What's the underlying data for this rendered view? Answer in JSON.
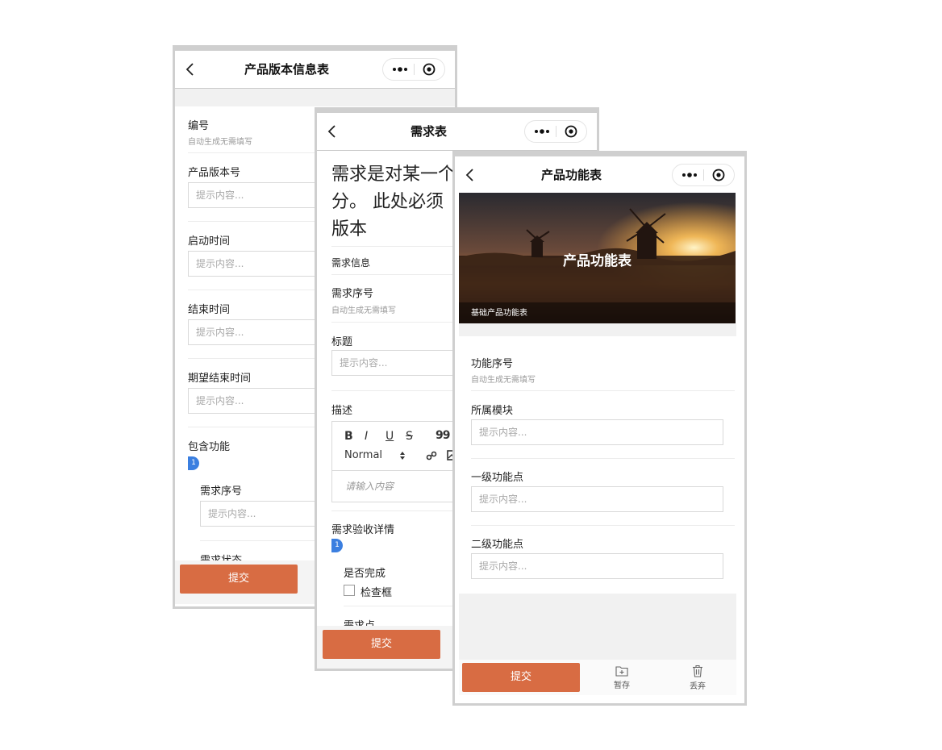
{
  "colors": {
    "accent": "#d86c43",
    "badge": "#3b7fe0"
  },
  "phone1": {
    "title": "产品版本信息表",
    "fields": {
      "number_label": "编号",
      "number_hint": "自动生成无需填写",
      "version_label": "产品版本号",
      "version_placeholder": "提示内容...",
      "start_label": "启动时间",
      "start_placeholder": "提示内容...",
      "end_label": "结束时间",
      "end_placeholder": "提示内容...",
      "expected_end_label": "期望结束时间",
      "expected_end_placeholder": "提示内容...",
      "features_label": "包含功能",
      "features_badge": "1",
      "req_no_label": "需求序号",
      "req_no_placeholder": "提示内容...",
      "req_status_label": "需求状态"
    },
    "submit": "提交"
  },
  "phone2": {
    "title": "需求表",
    "intro_line1": "需求是对某一个",
    "intro_line2": "分。 此处必须",
    "intro_line3": "版本",
    "section_label": "需求信息",
    "req_no_label": "需求序号",
    "req_no_hint": "自动生成无需填写",
    "title_label": "标题",
    "title_placeholder": "提示内容...",
    "desc_label": "描述",
    "toolbar": {
      "bold": "B",
      "italic": "I",
      "underline": "U",
      "strike": "S",
      "quote": "99",
      "heading": "Normal"
    },
    "editor_placeholder": "请输入内容",
    "acceptance_label": "需求验收详情",
    "acceptance_badge": "1",
    "done_label": "是否完成",
    "checkbox_label": "检查框",
    "point_label": "需求点",
    "submit": "提交"
  },
  "phone3": {
    "title": "产品功能表",
    "banner_title": "产品功能表",
    "banner_subtitle": "基础产品功能表",
    "feature_no_label": "功能序号",
    "feature_no_hint": "自动生成无需填写",
    "module_label": "所属模块",
    "module_placeholder": "提示内容...",
    "level1_label": "一级功能点",
    "level1_placeholder": "提示内容...",
    "level2_label": "二级功能点",
    "level2_placeholder": "提示内容...",
    "submit": "提交",
    "save_draft": "暂存",
    "discard": "丢弃"
  }
}
